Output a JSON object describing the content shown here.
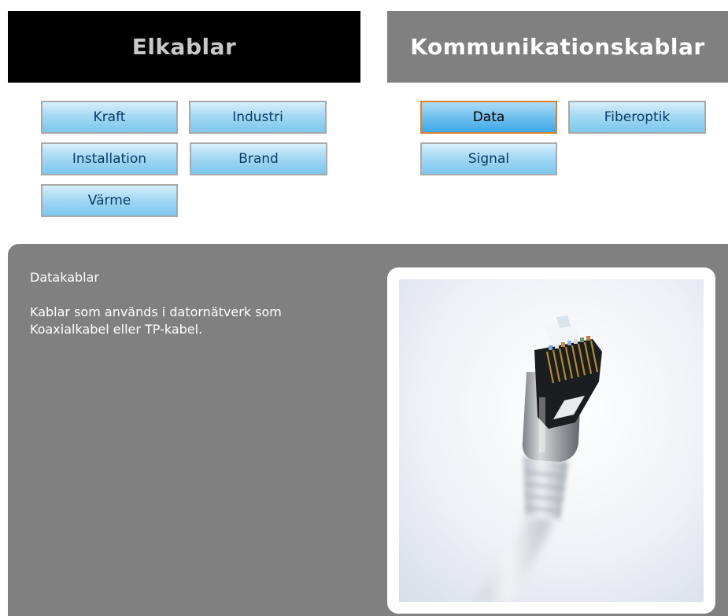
{
  "headers": {
    "left": "Elkablar",
    "right": "Kommunikationskablar"
  },
  "elkablar_buttons": {
    "kraft": "Kraft",
    "industri": "Industri",
    "installation": "Installation",
    "brand": "Brand",
    "varme": "Värme"
  },
  "komm_buttons": {
    "data": "Data",
    "fiberoptik": "Fiberoptik",
    "signal": "Signal"
  },
  "selected_category": "Data",
  "content": {
    "title": "Datakablar",
    "body": "Kablar som används i datornätverk som Koaxialkabel eller TP-kabel."
  },
  "colors": {
    "left_header_bg": "#000000",
    "right_header_bg": "#808080",
    "panel_bg": "#808080",
    "active_border": "#e0812a"
  },
  "image": {
    "subject": "ethernet-cable-rj45-connector"
  }
}
